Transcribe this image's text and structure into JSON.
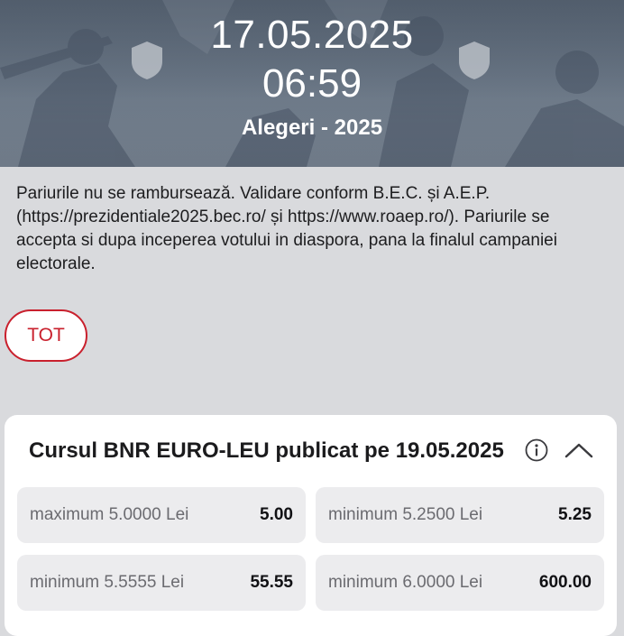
{
  "event": {
    "date": "17.05.2025",
    "time": "06:59",
    "name": "Alegeri - 2025"
  },
  "description": "Pariurile nu se rambursează. Validare conform B.E.C. și A.E.P. (https://prezidentiale2025.bec.ro/ și https://www.roaep.ro/). Pariurile se accepta si dupa inceperea votului in diaspora, pana la finalul campaniei electorale.",
  "filter": {
    "label": "TOT"
  },
  "market": {
    "title": "Cursul BNR EURO-LEU publicat pe 19.05.2025",
    "outcomes": [
      {
        "label": "maximum 5.0000 Lei",
        "odds": "5.00"
      },
      {
        "label": "minimum 5.2500 Lei",
        "odds": "5.25"
      },
      {
        "label": "minimum 5.5555 Lei",
        "odds": "55.55"
      },
      {
        "label": "minimum 6.0000 Lei",
        "odds": "600.00"
      }
    ]
  },
  "icons": {
    "team_shield": "shield-icon",
    "info": "info-icon",
    "collapse": "chevron-up-icon"
  },
  "colors": {
    "accent": "#c9202d",
    "page_background": "#d9dadd",
    "card_background": "#ffffff",
    "odd_cell_background": "#ececee"
  }
}
